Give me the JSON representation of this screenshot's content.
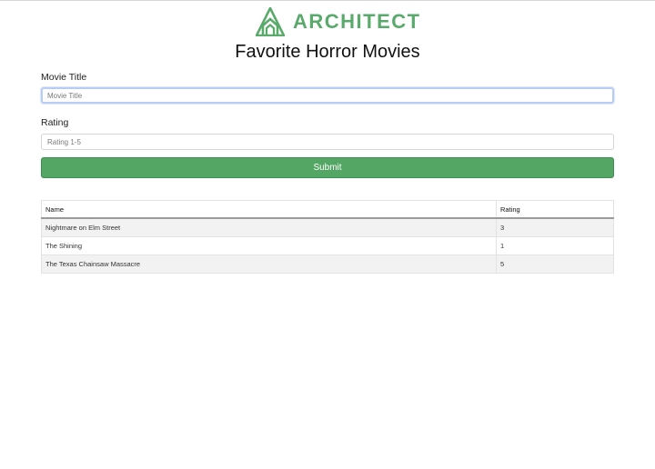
{
  "brand": {
    "name": "ARCHITECT",
    "logo_icon": "architect-a-logo-icon",
    "color": "#5aaa6c"
  },
  "page": {
    "title": "Favorite Horror Movies"
  },
  "form": {
    "movie_title": {
      "label": "Movie Title",
      "placeholder": "Movie Title",
      "value": ""
    },
    "rating": {
      "label": "Rating",
      "placeholder": "Rating 1-5",
      "value": ""
    },
    "submit_label": "Submit",
    "submit_color": "#53a663"
  },
  "table": {
    "columns": [
      "Name",
      "Rating"
    ],
    "rows": [
      {
        "name": "Nightmare on Elm Street",
        "rating": "3"
      },
      {
        "name": "The Shining",
        "rating": "1"
      },
      {
        "name": "The Texas Chainsaw Massacre",
        "rating": "5"
      }
    ]
  }
}
